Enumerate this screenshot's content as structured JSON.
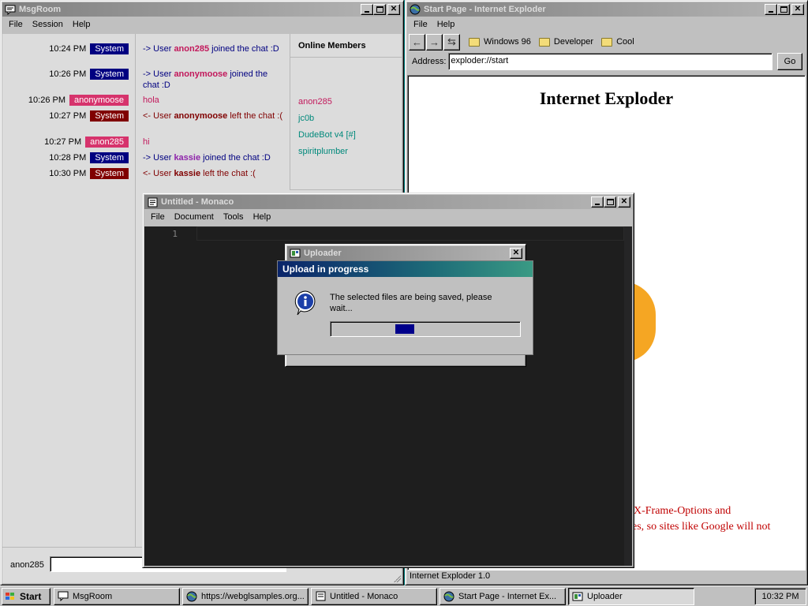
{
  "msgroom": {
    "title": "MsgRoom",
    "menu": [
      "File",
      "Session",
      "Help"
    ],
    "messages": [
      {
        "time": "10:24 PM",
        "user": "System",
        "user_color": "#000080",
        "pre": "-> User ",
        "name": "anon285",
        "name_color": "#c2185b",
        "post": " joined the chat :D",
        "text_color": "#000080"
      },
      {
        "time": "10:26 PM",
        "user": "System",
        "user_color": "#000080",
        "pre": "-> User ",
        "name": "anonymoose",
        "name_color": "#c2185b",
        "post": " joined the chat :D",
        "text_color": "#000080"
      },
      {
        "time": "10:26 PM",
        "user": "anonymoose",
        "user_color": "#d6336c",
        "pre": "",
        "name": "",
        "name_color": "",
        "post": "hola",
        "text_color": "#c2185b"
      },
      {
        "time": "10:27 PM",
        "user": "System",
        "user_color": "#800000",
        "pre": "<- User ",
        "name": "anonymoose",
        "name_color": "#800000",
        "post": " left the chat :(",
        "text_color": "#800000"
      },
      {
        "time": "10:27 PM",
        "user": "anon285",
        "user_color": "#d6336c",
        "pre": "",
        "name": "",
        "name_color": "",
        "post": "hi",
        "text_color": "#c2185b"
      },
      {
        "time": "10:28 PM",
        "user": "System",
        "user_color": "#000080",
        "pre": "-> User ",
        "name": "kassie",
        "name_color": "#8e24aa",
        "post": " joined the chat :D",
        "text_color": "#000080"
      },
      {
        "time": "10:30 PM",
        "user": "System",
        "user_color": "#800000",
        "pre": "<- User ",
        "name": "kassie",
        "name_color": "#800000",
        "post": " left the chat :(",
        "text_color": "#800000"
      }
    ],
    "members_heading": "Online Members",
    "members": [
      {
        "name": "anon285",
        "color": "#c2185b"
      },
      {
        "name": "jc0b",
        "color": "#00897b"
      },
      {
        "name": "DudeBot v4 [#]",
        "color": "#00897b"
      },
      {
        "name": "spiritplumber",
        "color": "#00897b"
      }
    ],
    "username": "anon285",
    "input_value": ""
  },
  "explorer": {
    "title": "Start Page - Internet Exploder",
    "menu": [
      "File",
      "Help"
    ],
    "favorites": [
      "Windows 96",
      "Developer",
      "Cool"
    ],
    "address_label": "Address:",
    "address_value": "exploder://start",
    "go_label": "Go",
    "heading": "Internet Exploder",
    "red_line_1": "X-Frame-Options and",
    "red_line_2": "es, so sites like Google will not",
    "status": "Internet Exploder 1.0"
  },
  "monaco": {
    "title": "Untitled - Monaco",
    "menu": [
      "File",
      "Document",
      "Tools",
      "Help"
    ],
    "line_number": "1"
  },
  "uploader": {
    "window_title": "Uploader",
    "dialog_title": "Upload in progress",
    "message": "The selected files are being saved, please wait...",
    "progress_fraction": 0.35
  },
  "taskbar": {
    "start_label": "Start",
    "tasks": [
      "MsgRoom",
      "https://webglsamples.org...",
      "Untitled - Monaco",
      "Start Page - Internet Ex...",
      "Uploader"
    ],
    "active_task": 4,
    "clock": "10:32 PM"
  },
  "colors": {
    "desktop": "#008080",
    "titlebar_active": "#0a246a",
    "progress_fill": "#00008b"
  }
}
